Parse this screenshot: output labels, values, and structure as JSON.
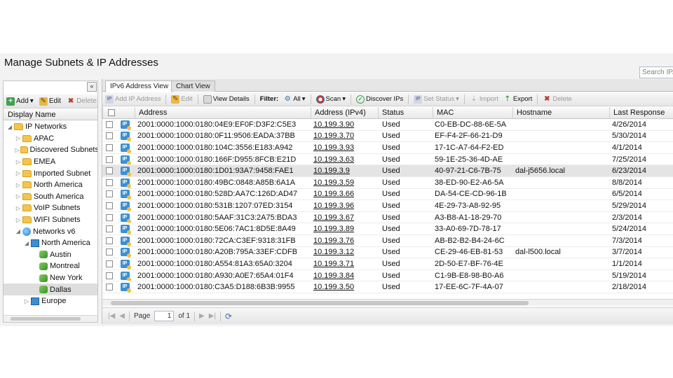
{
  "page": {
    "title": "Manage Subnets & IP Addresses",
    "search_placeholder": "Search IPA"
  },
  "left": {
    "collapse": "«",
    "toolbar": {
      "add": "Add",
      "edit": "Edit",
      "delete": "Delete"
    },
    "header": "Display Name",
    "tree": [
      {
        "label": "IP Networks",
        "expanded": true
      },
      {
        "label": "APAC"
      },
      {
        "label": "Discovered Subnets"
      },
      {
        "label": "EMEA"
      },
      {
        "label": "Imported Subnet"
      },
      {
        "label": "North America"
      },
      {
        "label": "South America"
      },
      {
        "label": "VoIP Subnets"
      },
      {
        "label": "WIFI Subnets"
      },
      {
        "label": "Networks v6"
      },
      {
        "label": "North America"
      },
      {
        "label": "Austin"
      },
      {
        "label": "Montreal"
      },
      {
        "label": "New York"
      },
      {
        "label": "Dallas"
      },
      {
        "label": "Europe"
      }
    ]
  },
  "tabs": [
    "IPv6 Address View",
    "Chart View"
  ],
  "toolbar": {
    "add_ip": "Add IP Address",
    "edit": "Edit",
    "view_details": "View Details",
    "filter": "Filter:",
    "filter_value": "All",
    "scan": "Scan",
    "discover": "Discover IPs",
    "set_status": "Set Status",
    "import": "Import",
    "export": "Export",
    "delete": "Delete"
  },
  "grid": {
    "columns": [
      "Address",
      "Address (IPv4)",
      "Status",
      "MAC",
      "Hostname",
      "Last Response"
    ],
    "rows": [
      [
        "2001:0000:1000:0180:04E9:EF0F:D3F2:C5E3",
        "10.199.3.90",
        "Used",
        "C0-EB-DC-88-6E-5A",
        "",
        "4/26/2014"
      ],
      [
        "2001:0000:1000:0180:0F11:9506:EADA:37BB",
        "10.199.3.70",
        "Used",
        "EF-F4-2F-66-21-D9",
        "",
        "5/30/2014"
      ],
      [
        "2001:0000:1000:0180:104C:3556:E183:A942",
        "10.199.3.93",
        "Used",
        "17-1C-A7-64-F2-ED",
        "",
        "4/1/2014"
      ],
      [
        "2001:0000:1000:0180:166F:D955:8FCB:E21D",
        "10.199.3.63",
        "Used",
        "59-1E-25-36-4D-AE",
        "",
        "7/25/2014"
      ],
      [
        "2001:0000:1000:0180:1D01:93A7:9458:FAE1",
        "10.199.3.9",
        "Used",
        "40-97-21-C6-7B-75",
        "dal-j5656.local",
        "6/23/2014"
      ],
      [
        "2001:0000:1000:0180:49BC:0848:A85B:6A1A",
        "10.199.3.59",
        "Used",
        "38-ED-90-E2-A6-5A",
        "",
        "8/8/2014"
      ],
      [
        "2001:0000:1000:0180:528D:AA7C:126D:AD47",
        "10.199.3.66",
        "Used",
        "DA-54-CE-CD-96-1B",
        "",
        "6/5/2014"
      ],
      [
        "2001:0000:1000:0180:531B:1207:07ED:3154",
        "10.199.3.96",
        "Used",
        "4E-29-73-A8-92-95",
        "",
        "5/29/2014"
      ],
      [
        "2001:0000:1000:0180:5AAF:31C3:2A75:BDA3",
        "10.199.3.67",
        "Used",
        "A3-B8-A1-18-29-70",
        "",
        "2/3/2014"
      ],
      [
        "2001:0000:1000:0180:5E06:7AC1:8D5E:8A49",
        "10.199.3.89",
        "Used",
        "33-A0-69-7D-78-17",
        "",
        "5/24/2014"
      ],
      [
        "2001:0000:1000:0180:72CA:C3EF:9318:31FB",
        "10.199.3.76",
        "Used",
        "AB-B2-B2-B4-24-6C",
        "",
        "7/3/2014"
      ],
      [
        "2001:0000:1000:0180:A20B:795A:33EF:CDFB",
        "10.199.3.12",
        "Used",
        "CE-29-46-EB-81-53",
        "dal-l500.local",
        "3/7/2014"
      ],
      [
        "2001:0000:1000:0180:A554:81A3:65A0:3204",
        "10.199.3.71",
        "Used",
        "2D-50-E7-BF-76-4E",
        "",
        "1/1/2014"
      ],
      [
        "2001:0000:1000:0180:A930:A0E7:65A4:01F4",
        "10.199.3.84",
        "Used",
        "C1-9B-E8-98-B0-A6",
        "",
        "5/19/2014"
      ],
      [
        "2001:0000:1000:0180:C3A5:D188:6B3B:9955",
        "10.199.3.50",
        "Used",
        "17-EE-6C-7F-4A-07",
        "",
        "2/18/2014"
      ]
    ]
  },
  "pager": {
    "page_label": "Page",
    "page_value": "1",
    "of_label": "of 1"
  }
}
